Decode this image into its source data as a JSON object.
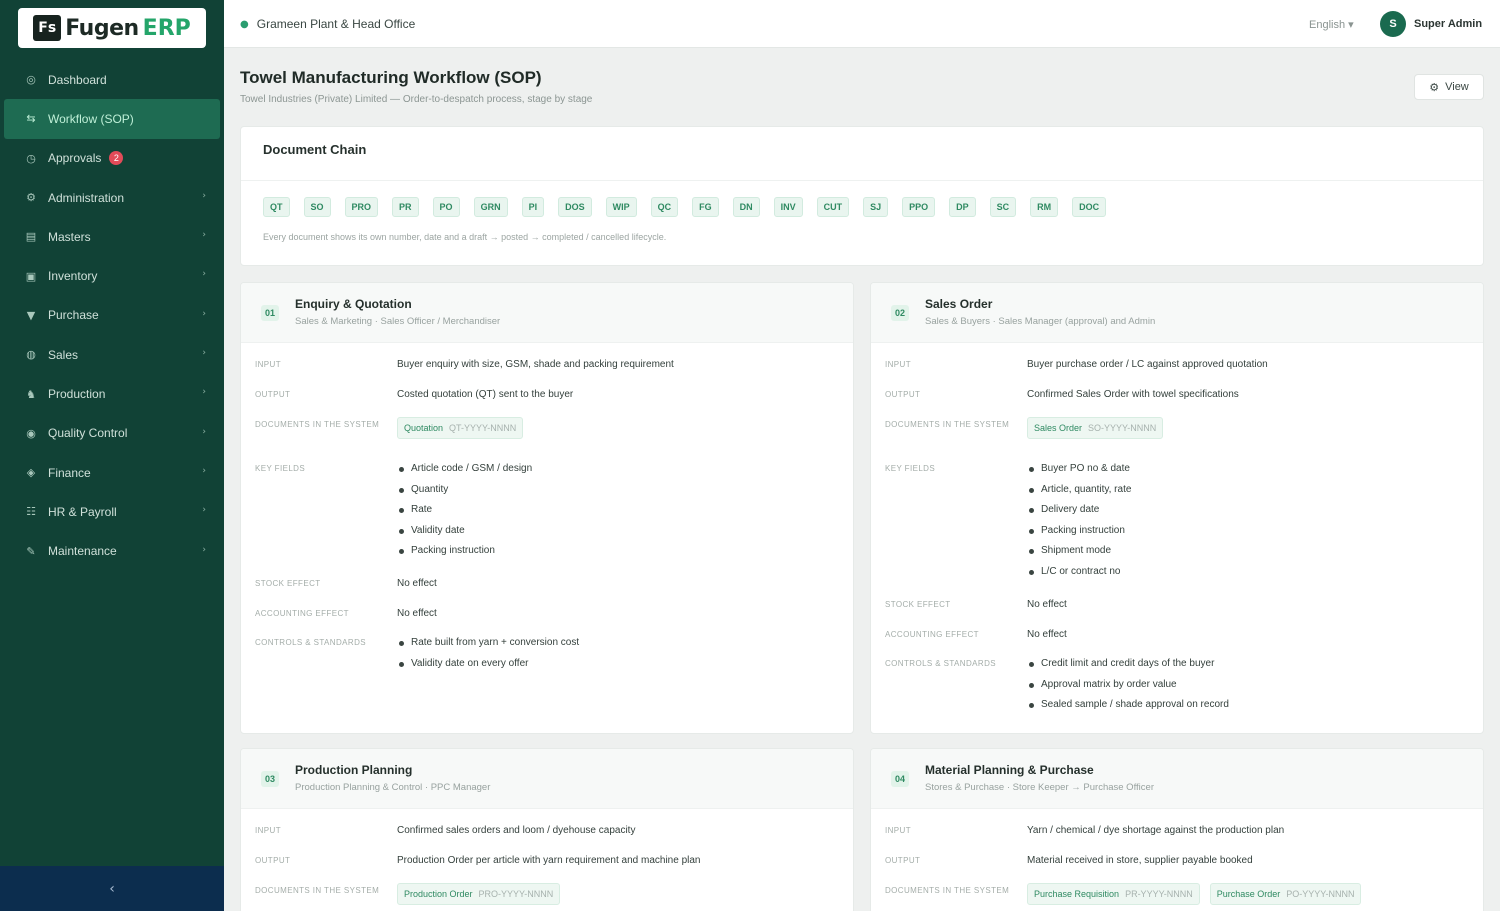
{
  "app": {
    "logo_mark": "Fs",
    "logo_text": "Fugen",
    "logo_erp": "ERP"
  },
  "sidebar": {
    "items": [
      {
        "label": "Dashboard",
        "icon": "dashboard-icon",
        "glyph": "◎"
      },
      {
        "label": "Workflow (SOP)",
        "icon": "workflow-icon",
        "glyph": "⇆"
      },
      {
        "label": "Approvals",
        "icon": "approvals-icon",
        "glyph": "◷",
        "badge": "2"
      },
      {
        "label": "Administration",
        "icon": "admin-icon",
        "glyph": "⚙"
      },
      {
        "label": "Masters",
        "icon": "masters-icon",
        "glyph": "▤"
      },
      {
        "label": "Inventory",
        "icon": "inventory-icon",
        "glyph": "▣"
      },
      {
        "label": "Purchase",
        "icon": "purchase-icon",
        "glyph": "▼"
      },
      {
        "label": "Sales",
        "icon": "sales-icon",
        "glyph": "◍"
      },
      {
        "label": "Production",
        "icon": "production-icon",
        "glyph": "♞"
      },
      {
        "label": "Quality Control",
        "icon": "quality-icon",
        "glyph": "◉"
      },
      {
        "label": "Finance",
        "icon": "finance-icon",
        "glyph": "◈"
      },
      {
        "label": "HR & Payroll",
        "icon": "hr-icon",
        "glyph": "☷"
      },
      {
        "label": "Maintenance",
        "icon": "maintenance-icon",
        "glyph": "✎"
      }
    ],
    "collapse_glyph": "‹"
  },
  "topbar": {
    "org_glyph": "●",
    "org": "Grameen Plant & Head Office",
    "language": "English ▾",
    "avatar": "S",
    "user": "Super Admin"
  },
  "page": {
    "title": "Towel Manufacturing Workflow (SOP)",
    "subtitle": "Towel Industries (Private) Limited — Order-to-despatch process, stage by stage",
    "view_glyph": "⚙",
    "view_label": "View"
  },
  "chain": {
    "title": "Document Chain",
    "chips": [
      "QT",
      "SO",
      "PRO",
      "PR",
      "PO",
      "GRN",
      "PI",
      "DOS",
      "WIP",
      "QC",
      "FG",
      "DN",
      "INV",
      "CUT",
      "SJ",
      "PPO",
      "DP",
      "SC",
      "RM",
      "DOC"
    ],
    "note": "Every document shows its own number, date and a draft → posted → completed / cancelled lifecycle."
  },
  "stages": [
    {
      "num": "01",
      "title": "Enquiry & Quotation",
      "sub": "Sales & Marketing · Sales Officer / Merchandiser",
      "input_label": "INPUT",
      "input": "Buyer enquiry with size, GSM, shade and packing requirement",
      "output_label": "OUTPUT",
      "output": "Costed quotation (QT) sent to the buyer",
      "docs_label": "DOCUMENTS IN THE SYSTEM",
      "docs": [
        {
          "name": "Quotation",
          "code": "QT-YYYY-NNNN"
        }
      ],
      "fields_label": "KEY FIELDS",
      "fields": [
        "Article code / GSM / design",
        "Quantity",
        "Rate",
        "Validity date",
        "Packing instruction"
      ],
      "stock_label": "STOCK EFFECT",
      "stock": "No effect",
      "acct_label": "ACCOUNTING EFFECT",
      "acct": "No effect",
      "controls_label": "CONTROLS & STANDARDS",
      "controls": [
        "Rate built from yarn + conversion cost",
        "Validity date on every offer"
      ]
    },
    {
      "num": "02",
      "title": "Sales Order",
      "sub": "Sales & Buyers · Sales Manager (approval) and Admin",
      "input_label": "INPUT",
      "input": "Buyer purchase order / LC against approved quotation",
      "output_label": "OUTPUT",
      "output": "Confirmed Sales Order with towel specifications",
      "docs_label": "DOCUMENTS IN THE SYSTEM",
      "docs": [
        {
          "name": "Sales Order",
          "code": "SO-YYYY-NNNN"
        }
      ],
      "fields_label": "KEY FIELDS",
      "fields": [
        "Buyer PO no & date",
        "Article, quantity, rate",
        "Delivery date",
        "Packing instruction",
        "Shipment mode",
        "L/C or contract no"
      ],
      "stock_label": "STOCK EFFECT",
      "stock": "No effect",
      "acct_label": "ACCOUNTING EFFECT",
      "acct": "No effect",
      "controls_label": "CONTROLS & STANDARDS",
      "controls": [
        "Credit limit and credit days of the buyer",
        "Approval matrix by order value",
        "Sealed sample / shade approval on record"
      ]
    },
    {
      "num": "03",
      "title": "Production Planning",
      "sub": "Production Planning & Control · PPC Manager",
      "input_label": "INPUT",
      "input": "Confirmed sales orders and loom / dyehouse capacity",
      "output_label": "OUTPUT",
      "output": "Production Order per article with yarn requirement and machine plan",
      "docs_label": "DOCUMENTS IN THE SYSTEM",
      "docs": [
        {
          "name": "Production Order",
          "code": "PRO-YYYY-NNNN"
        }
      ]
    },
    {
      "num": "04",
      "title": "Material Planning & Purchase",
      "sub": "Stores & Purchase · Store Keeper → Purchase Officer",
      "input_label": "INPUT",
      "input": "Yarn / chemical / dye shortage against the production plan",
      "output_label": "OUTPUT",
      "output": "Material received in store, supplier payable booked",
      "docs_label": "DOCUMENTS IN THE SYSTEM",
      "docs": [
        {
          "name": "Purchase Requisition",
          "code": "PR-YYYY-NNNN"
        },
        {
          "name": "Purchase Order",
          "code": "PO-YYYY-NNNN"
        }
      ]
    }
  ]
}
